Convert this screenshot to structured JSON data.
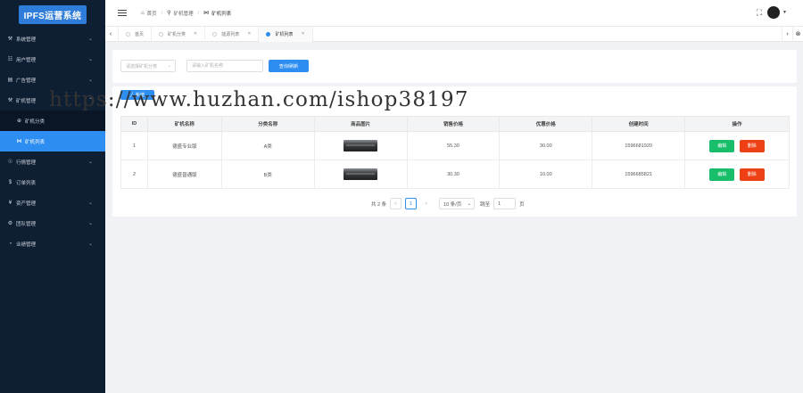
{
  "app": {
    "logo": "IPFS运营系统"
  },
  "sidebar": {
    "items": [
      {
        "icon": "wrench-icon",
        "glyph": "⚒",
        "label": "系统管理",
        "chevron": "⌄"
      },
      {
        "icon": "users-icon",
        "glyph": "☷",
        "label": "用户管理",
        "chevron": "⌄"
      },
      {
        "icon": "ad-icon",
        "glyph": "▤",
        "label": "广告管理",
        "chevron": "⌄"
      },
      {
        "icon": "miner-icon",
        "glyph": "⚒",
        "label": "矿机管理",
        "chevron": "⌃"
      },
      {
        "icon": "circle-plus-icon",
        "glyph": "⊕",
        "label": "矿机分类"
      },
      {
        "icon": "bowtie-icon",
        "glyph": "⋈",
        "label": "矿机列表"
      },
      {
        "icon": "market-icon",
        "glyph": "☉",
        "label": "行情管理",
        "chevron": "⌄"
      },
      {
        "icon": "dollar-icon",
        "glyph": "$",
        "label": "订单列表"
      },
      {
        "icon": "yen-icon",
        "glyph": "¥",
        "label": "资产管理",
        "chevron": "⌄"
      },
      {
        "icon": "team-icon",
        "glyph": "⚙",
        "label": "团队管理",
        "chevron": "⌄"
      },
      {
        "icon": "chart-icon",
        "glyph": "◔",
        "label": "业绩管理",
        "chevron": "⌄"
      }
    ]
  },
  "header": {
    "breadcrumb": [
      "首页",
      "矿机管理",
      "矿机列表"
    ]
  },
  "tabs": [
    {
      "label": "首页",
      "closable": false
    },
    {
      "label": "矿机分类",
      "closable": true
    },
    {
      "label": "能源列表",
      "closable": true
    },
    {
      "label": "矿机列表",
      "closable": true,
      "active": true
    }
  ],
  "filters": {
    "category_placeholder": "请选择矿机分类",
    "name_placeholder": "请输入矿机名称",
    "query_label": "查询/刷新"
  },
  "toolbar": {
    "add_label": "新增"
  },
  "table": {
    "columns": [
      "ID",
      "矿机名称",
      "分类名称",
      "商品图片",
      "销售价格",
      "优惠价格",
      "创建时间",
      "操作"
    ],
    "rows": [
      {
        "id": "1",
        "name": "德盛专业版",
        "category": "A类",
        "price": "55.30",
        "discount": "30.00",
        "created": "1596681920"
      },
      {
        "id": "2",
        "name": "德盛普通版",
        "category": "B类",
        "price": "30.30",
        "discount": "10.00",
        "created": "1596685821"
      }
    ],
    "edit_label": "编辑",
    "delete_label": "删除"
  },
  "pagination": {
    "total_text": "共 2 条",
    "prev": "<",
    "current_page": "1",
    "next": ">",
    "page_size": "10 条/页",
    "jump_label": "跳至",
    "jump_value": "1",
    "page_unit": "页"
  },
  "watermark": "https://www.huzhan.com/ishop38197",
  "colors": {
    "sidebar": "#0f1f33",
    "primary": "#2e8df0",
    "success": "#19be6b",
    "danger": "#ed4014"
  }
}
